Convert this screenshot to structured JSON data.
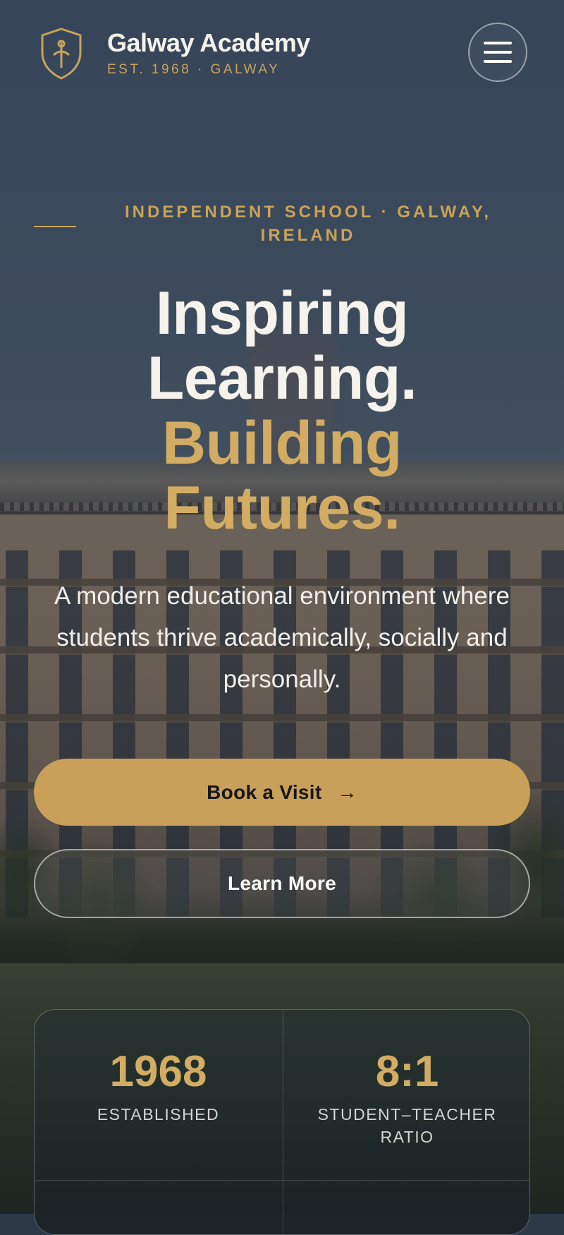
{
  "header": {
    "brand_name": "Galway Academy",
    "brand_sub": "EST. 1968 · GALWAY",
    "logo_icon": "shield-tree-icon",
    "menu_icon": "hamburger-menu-icon"
  },
  "hero": {
    "eyebrow": "INDEPENDENT SCHOOL · GALWAY, IRELAND",
    "headline_line1": "Inspiring Learning.",
    "headline_line2": "Building Futures.",
    "lead": "A modern educational environment where students thrive academically, socially and personally.",
    "primary_button": "Book a Visit",
    "primary_button_icon": "arrow-right-icon",
    "secondary_button": "Learn More"
  },
  "stats": [
    {
      "value": "1968",
      "label": "ESTABLISHED"
    },
    {
      "value": "8:1",
      "label": "STUDENT–TEACHER RATIO"
    }
  ],
  "colors": {
    "accent_gold": "#c9a05a",
    "heading_light": "#f6f2ec"
  }
}
